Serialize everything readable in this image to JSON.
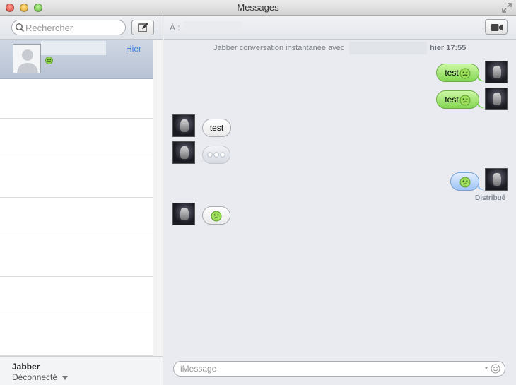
{
  "window": {
    "title": "Messages"
  },
  "sidebar": {
    "search_placeholder": "Rechercher",
    "conversations": [
      {
        "time": "Hier",
        "selected": true
      }
    ],
    "account": {
      "name": "Jabber",
      "status": "Déconnecté"
    }
  },
  "main": {
    "to_label": "À :",
    "conversation_header": {
      "text": "Jabber conversation instantanée avec",
      "time": "hier 17:55"
    },
    "messages": [
      {
        "from": "me",
        "text": "test",
        "emoji": "smiley-icon"
      },
      {
        "from": "me",
        "text": "test",
        "emoji": "smiley-icon"
      },
      {
        "from": "them",
        "text": "test"
      },
      {
        "from": "them",
        "typing": true
      },
      {
        "from": "me",
        "emoji": "smiley-icon"
      },
      {
        "from": "them",
        "emoji": "smiley-icon"
      }
    ],
    "delivered_label": "Distribué",
    "input_placeholder": "iMessage"
  },
  "colors": {
    "sent_bubble": "#82d651",
    "received_bubble": "#ffffff",
    "imessage_bubble": "#9cc3f6",
    "link_blue": "#3b7de0"
  }
}
